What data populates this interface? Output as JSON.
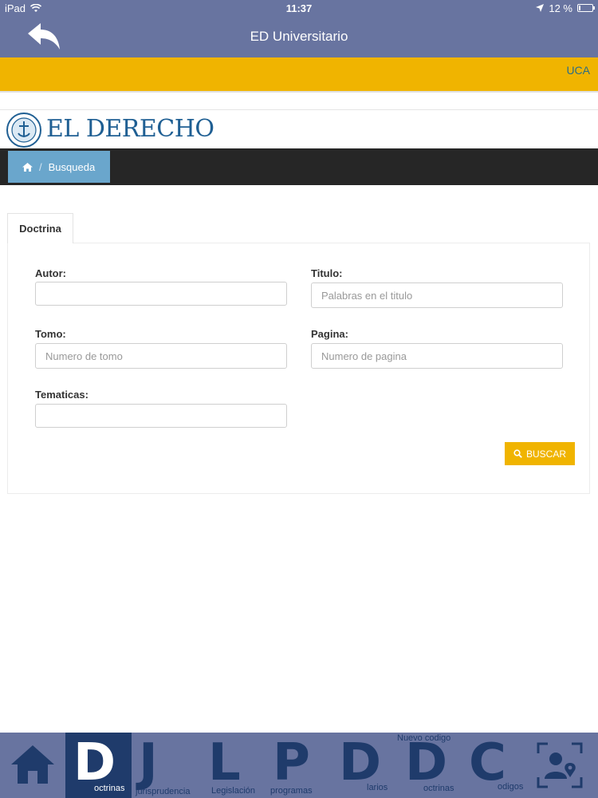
{
  "status": {
    "device": "iPad",
    "time": "11:37",
    "battery": "12 %",
    "battery_level": 0.12
  },
  "nav": {
    "title": "ED Universitario"
  },
  "banner": {
    "label": "UCA"
  },
  "logo": {
    "text": "EL DERECHO"
  },
  "breadcrumb": {
    "sep": "/",
    "current": "Busqueda"
  },
  "tab": {
    "label": "Doctrina"
  },
  "form": {
    "autor": {
      "label": "Autor:",
      "placeholder": ""
    },
    "titulo": {
      "label": "Titulo:",
      "placeholder": "Palabras en el titulo"
    },
    "tomo": {
      "label": "Tomo:",
      "placeholder": "Numero de tomo"
    },
    "pagina": {
      "label": "Pagina:",
      "placeholder": "Numero de pagina"
    },
    "tematicas": {
      "label": "Tematicas:",
      "placeholder": ""
    },
    "submit": "BUSCAR"
  },
  "tabbar": {
    "items": [
      {
        "letter": "D",
        "label": "octrinas",
        "active": true
      },
      {
        "letter": "J",
        "label": "jurisprudencia"
      },
      {
        "letter": "L",
        "label": "Legislación"
      },
      {
        "letter": "P",
        "label": "programas"
      },
      {
        "letter": "D",
        "label": "larios"
      },
      {
        "letter": "D",
        "label": "octrinas",
        "sublabel": "Nuevo codigo"
      },
      {
        "letter": "C",
        "label": "odigos"
      }
    ]
  },
  "colors": {
    "header": "#6874a0",
    "accent": "#f0b400",
    "tabbar_active": "#1f3b6b",
    "breadcrumb": "#6aa6cc",
    "logo": "#1f5f93"
  },
  "icons": {
    "back": "back-arrow-icon",
    "home": "home-icon",
    "profile": "profile-location-icon",
    "search": "search-icon"
  }
}
